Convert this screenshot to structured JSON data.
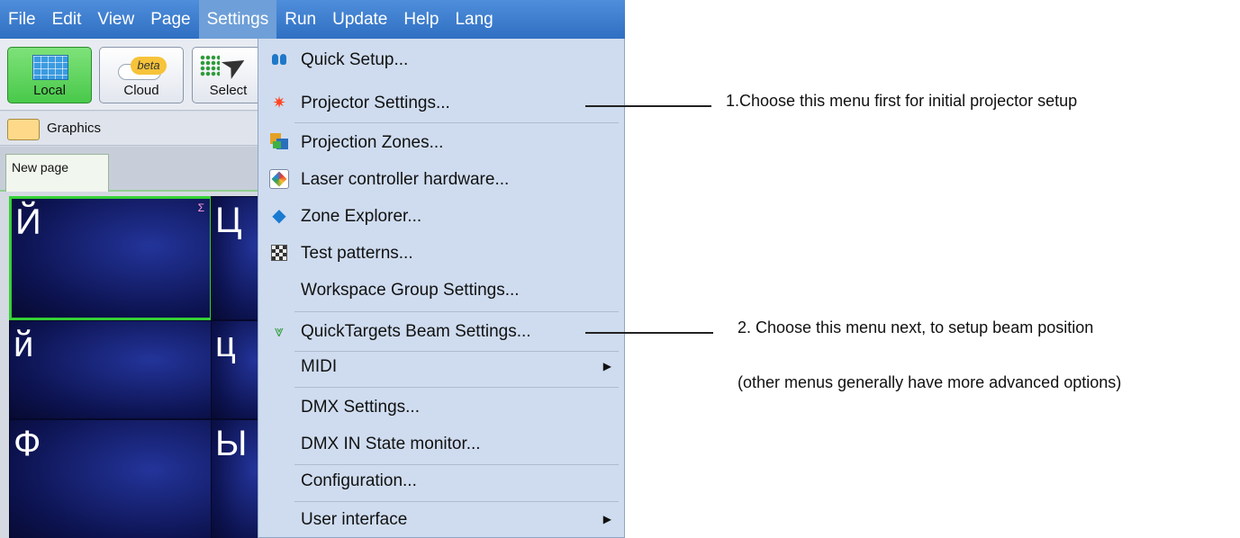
{
  "menubar": {
    "items": [
      "File",
      "Edit",
      "View",
      "Page",
      "Settings",
      "Run",
      "Update",
      "Help",
      "Lang"
    ],
    "active": "Settings"
  },
  "toolbar": {
    "local_label": "Local",
    "cloud_label": "Cloud",
    "cloud_badge": "beta",
    "select_label": "Select"
  },
  "strip": {
    "graphics_label": "Graphics"
  },
  "tabs": {
    "page_tab": "New page"
  },
  "cues": {
    "col1": [
      "Й",
      "й",
      "Ф"
    ],
    "col2": [
      "Ц",
      "ц",
      "Ы"
    ],
    "sigma": "Σ"
  },
  "settings_menu": {
    "items": [
      {
        "label": "Quick Setup...",
        "icon": "footprints-icon"
      },
      {
        "label": "Projector Settings...",
        "icon": "laser-burst-icon"
      },
      {
        "label": "Projection Zones...",
        "icon": "zones-icon"
      },
      {
        "label": "Laser controller hardware...",
        "icon": "hardware-icon"
      },
      {
        "label": "Zone Explorer...",
        "icon": "zone-explorer-icon"
      },
      {
        "label": "Test patterns...",
        "icon": "test-pattern-icon"
      },
      {
        "label": "Workspace Group Settings...",
        "icon": ""
      },
      {
        "label": "QuickTargets Beam Settings...",
        "icon": "quicktargets-icon"
      },
      {
        "label": "MIDI",
        "icon": "",
        "submenu": true
      },
      {
        "label": "DMX Settings...",
        "icon": ""
      },
      {
        "label": "DMX IN State monitor...",
        "icon": ""
      },
      {
        "label": "Configuration...",
        "icon": ""
      },
      {
        "label": "User interface",
        "icon": "",
        "submenu": true
      }
    ],
    "submenu_arrow": "▶"
  },
  "annotations": {
    "note1": "1.Choose this menu first for initial projector setup",
    "note2": "2. Choose this menu next, to setup beam position",
    "note3": "(other menus generally have more advanced options)"
  },
  "colors": {
    "menubar": "#2f6fc2",
    "dropdown": "#cfdcef",
    "local_button": "#49c94a",
    "cue_background": "#0c124e",
    "selected_cue_border": "#35d135"
  }
}
